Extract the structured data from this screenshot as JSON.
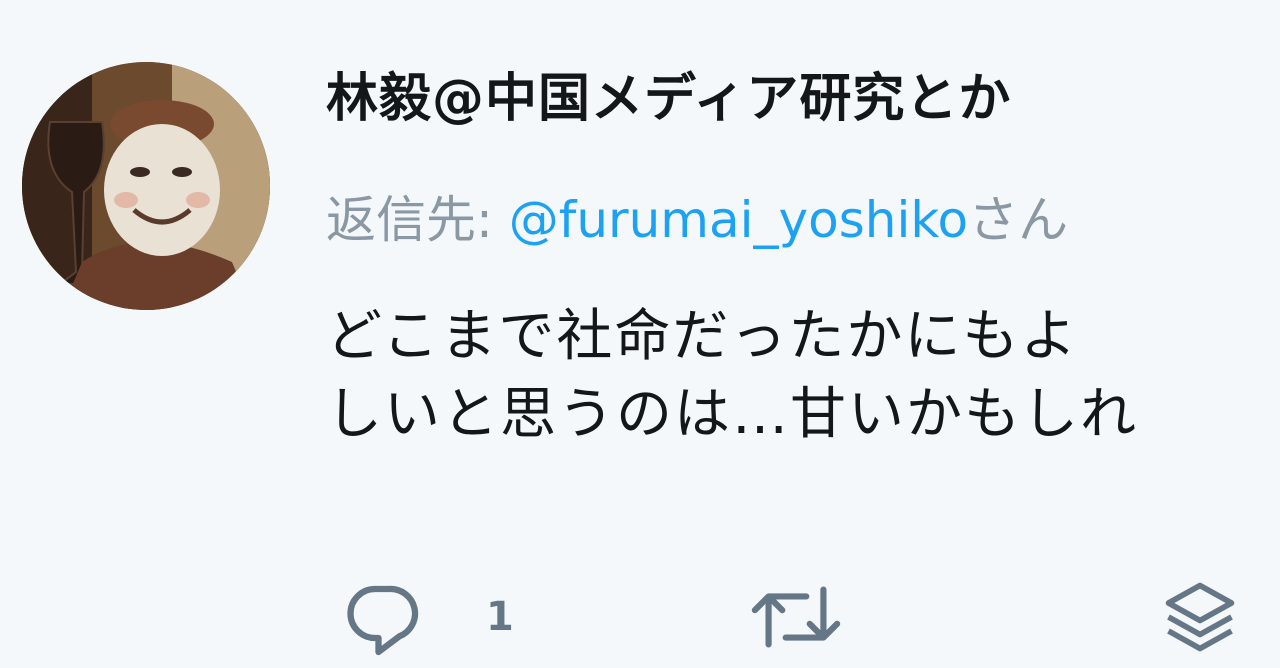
{
  "tweet": {
    "author_name": "林毅@中国メディア研究とか",
    "reply_prefix": "返信先: ",
    "reply_mention": "@furumai_yoshiko",
    "reply_suffix": "さん",
    "text_line1": "どこまで社命だったかにもよ",
    "text_line2": "しいと思うのは…甘いかもしれ"
  },
  "actions": {
    "reply_count": "1"
  },
  "colors": {
    "background": "#f5f8fa",
    "text": "#14171a",
    "muted": "#8a98a5",
    "link": "#1da1f2",
    "icon": "#657786"
  },
  "icons": {
    "reply": "reply-icon",
    "retweet": "retweet-icon",
    "share": "layers-icon"
  }
}
